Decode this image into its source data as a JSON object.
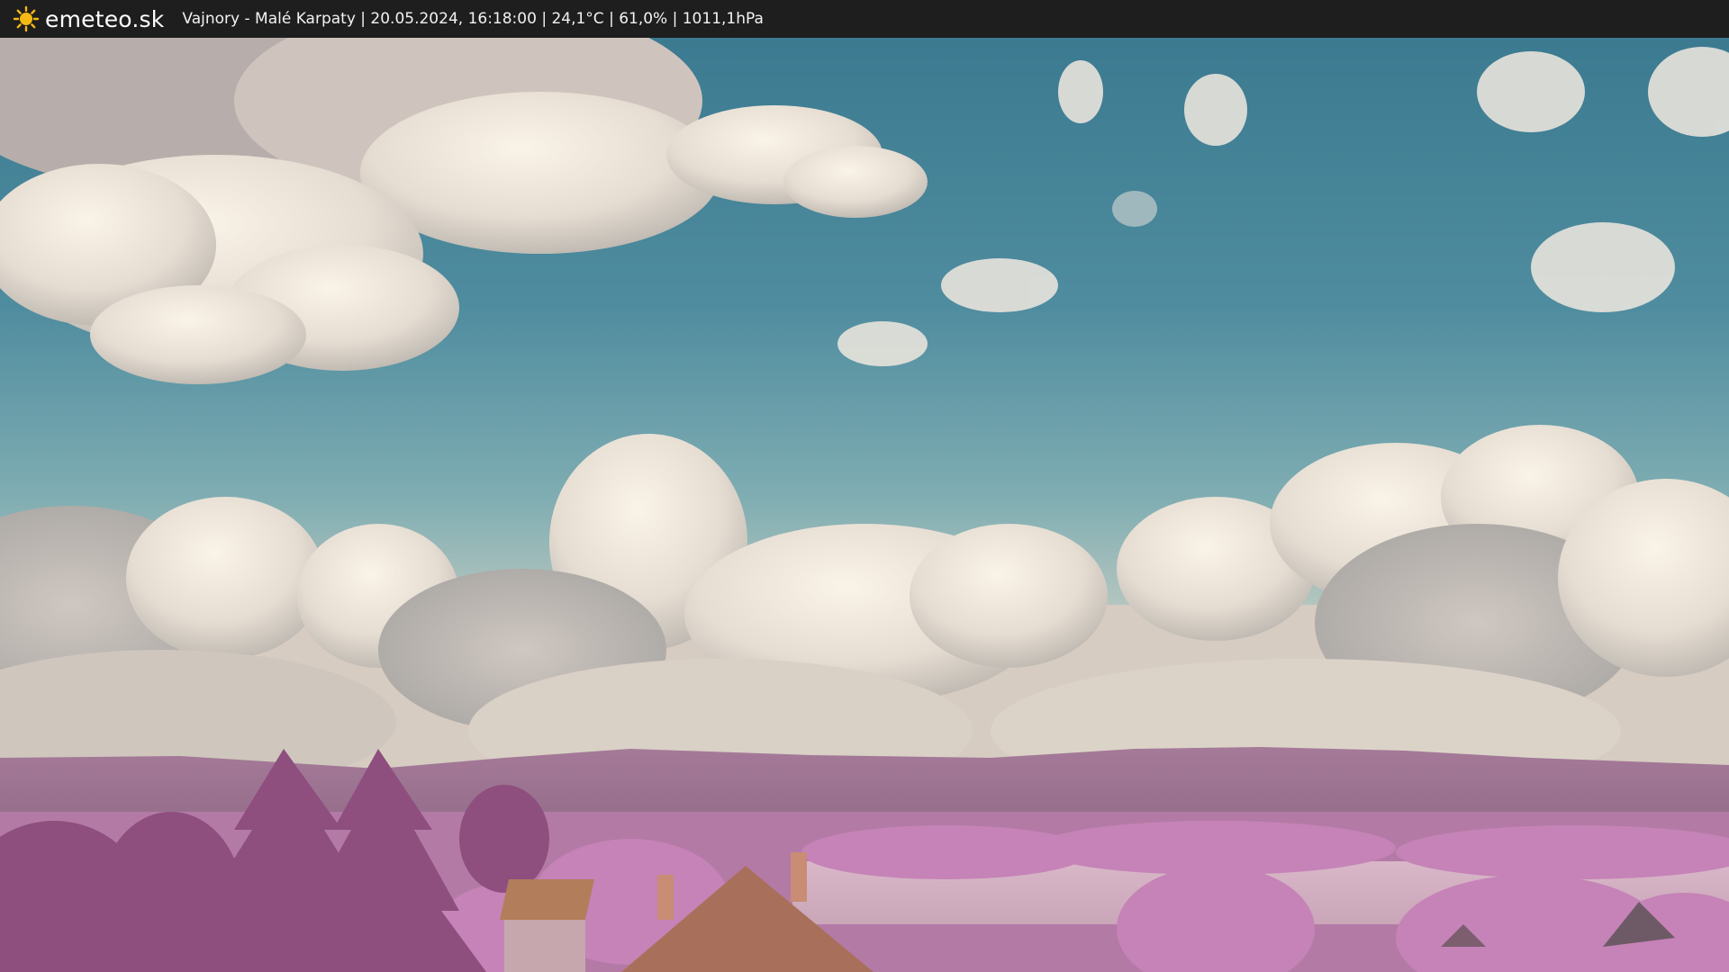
{
  "header": {
    "logo_text": "emeteo.sk",
    "logo_icon": "sun-icon",
    "caption": "Vajnory - Malé Karpaty | 20.05.2024, 16:18:00 | 24,1°C | 61,0% | 1011,1hPa"
  },
  "colors": {
    "bar": "#1e1e1e",
    "sun": "#f5b914",
    "sky_top": "#3f7f95",
    "sky_mid": "#6fa3ad",
    "cloud": "#efe6db",
    "hills": "#a77a99",
    "foliage": "#c07ab0",
    "roof": "#b0826a"
  }
}
